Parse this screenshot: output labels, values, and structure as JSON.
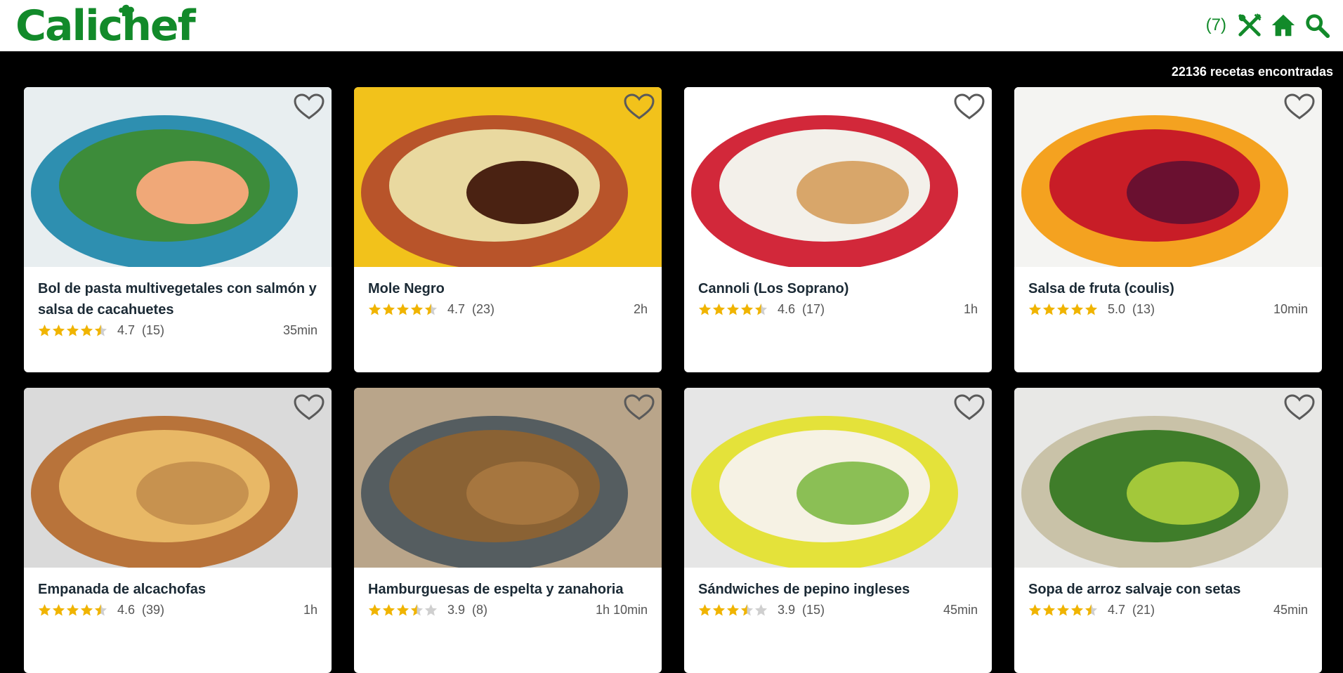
{
  "header": {
    "logo_text": "Calichef",
    "count": "(7)",
    "brand_color": "#128a2a",
    "icons": [
      "utensils-icon",
      "home-icon",
      "search-icon"
    ]
  },
  "results_text": "22136 recetas encontradas",
  "recipes": [
    {
      "title": "Bol de pasta multivegetales con salmón y salsa de cacahuetes",
      "stars": 4.5,
      "rating": "4.7",
      "reviews": "(15)",
      "time": "35min",
      "palette": [
        "#e8eef0",
        "#2e8fb0",
        "#3d8c3a",
        "#f0a878"
      ]
    },
    {
      "title": "Mole Negro",
      "stars": 4.5,
      "rating": "4.7",
      "reviews": "(23)",
      "time": "2h",
      "palette": [
        "#f2c21b",
        "#b8542a",
        "#e9d9a0",
        "#4a2212"
      ]
    },
    {
      "title": "Cannoli (Los Soprano)",
      "stars": 4.5,
      "rating": "4.6",
      "reviews": "(17)",
      "time": "1h",
      "palette": [
        "#ffffff",
        "#d2283a",
        "#f3f0ea",
        "#d8a66a"
      ]
    },
    {
      "title": "Salsa de fruta (coulis)",
      "stars": 5,
      "rating": "5.0",
      "reviews": "(13)",
      "time": "10min",
      "palette": [
        "#f4f4f2",
        "#f4a220",
        "#c81d27",
        "#6a1030"
      ]
    },
    {
      "title": "Empanada de alcachofas",
      "stars": 4.5,
      "rating": "4.6",
      "reviews": "(39)",
      "time": "1h",
      "palette": [
        "#dadada",
        "#b8733a",
        "#e8b866",
        "#c7924f"
      ]
    },
    {
      "title": "Hamburguesas de espelta y zanahoria",
      "stars": 3.5,
      "rating": "3.9",
      "reviews": "(8)",
      "time": "1h 10min",
      "palette": [
        "#b9a58a",
        "#555d60",
        "#8a6234",
        "#a6763f"
      ]
    },
    {
      "title": "Sándwiches de pepino ingleses",
      "stars": 3.5,
      "rating": "3.9",
      "reviews": "(15)",
      "time": "45min",
      "palette": [
        "#e6e6e6",
        "#e4e23a",
        "#f6f2e4",
        "#8bbf55"
      ]
    },
    {
      "title": "Sopa de arroz salvaje con setas",
      "stars": 4.5,
      "rating": "4.7",
      "reviews": "(21)",
      "time": "45min",
      "palette": [
        "#e8e8e6",
        "#c9c2a8",
        "#3f7d2a",
        "#a3c83a"
      ]
    }
  ]
}
